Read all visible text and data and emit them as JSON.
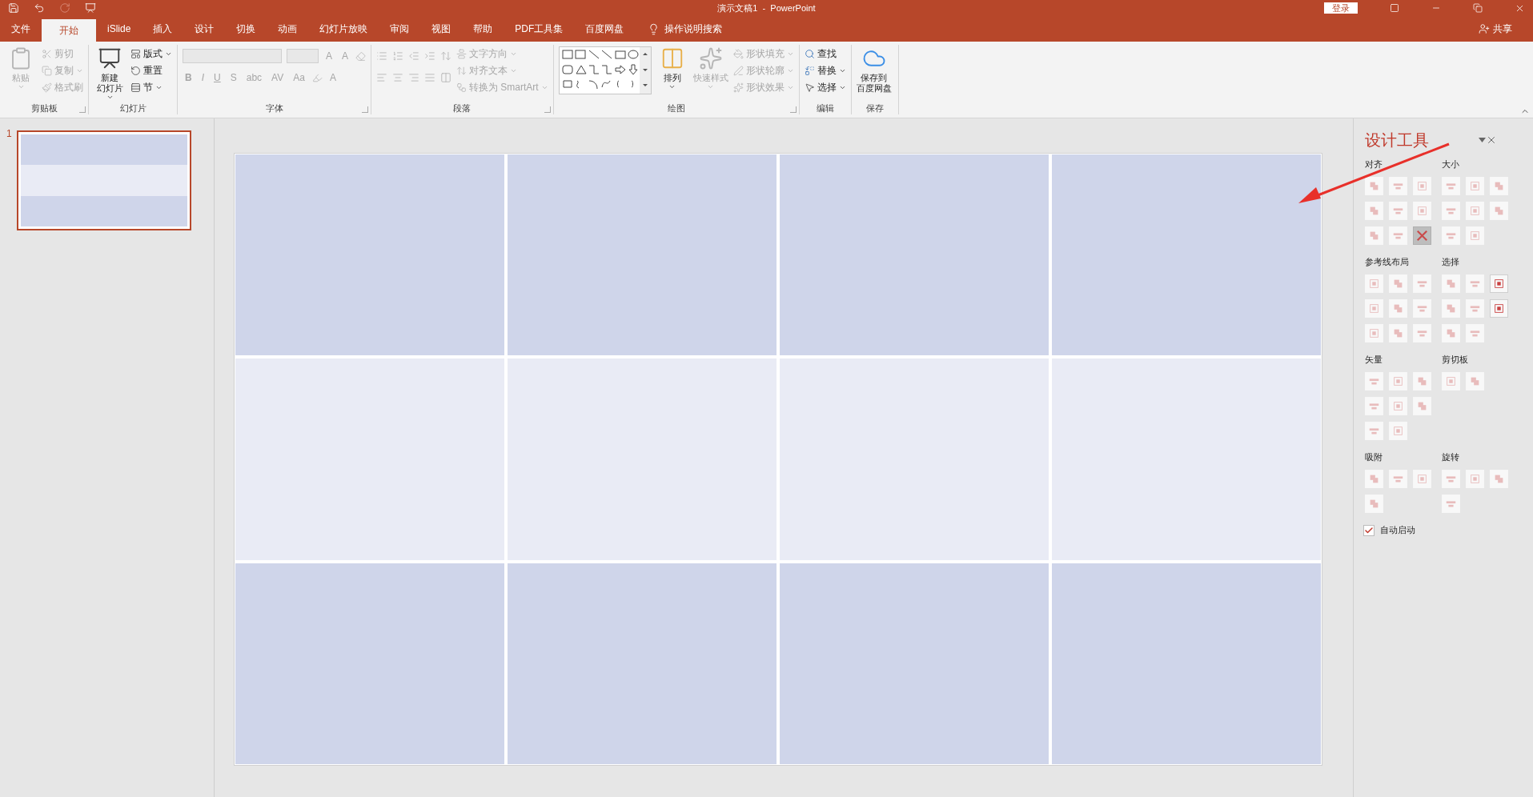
{
  "window": {
    "title": "演示文稿1  -  PowerPoint",
    "login": "登录"
  },
  "tabs": [
    {
      "label": "文件",
      "selected": false
    },
    {
      "label": "开始",
      "selected": true
    },
    {
      "label": "iSlide",
      "selected": false
    },
    {
      "label": "插入",
      "selected": false
    },
    {
      "label": "设计",
      "selected": false
    },
    {
      "label": "切换",
      "selected": false
    },
    {
      "label": "动画",
      "selected": false
    },
    {
      "label": "幻灯片放映",
      "selected": false
    },
    {
      "label": "审阅",
      "selected": false
    },
    {
      "label": "视图",
      "selected": false
    },
    {
      "label": "帮助",
      "selected": false
    },
    {
      "label": "PDF工具集",
      "selected": false
    },
    {
      "label": "百度网盘",
      "selected": false
    }
  ],
  "tell_me": "操作说明搜索",
  "share": "共享",
  "ribbon": [
    {
      "label": "剪贴板",
      "launcher": true,
      "items": [
        {
          "kind": "large",
          "label_lines": [
            "粘贴"
          ],
          "disabled": true,
          "dropdown": true
        },
        {
          "kind": "stack",
          "rows": [
            {
              "label": "剪切",
              "disabled": true,
              "dropdown": false
            },
            {
              "label": "复制",
              "disabled": true,
              "dropdown": true
            },
            {
              "label": "格式刷",
              "disabled": true,
              "dropdown": false
            }
          ]
        }
      ]
    },
    {
      "label": "幻灯片",
      "launcher": false,
      "items": [
        {
          "kind": "large",
          "label_lines": [
            "新建",
            "幻灯片"
          ],
          "disabled": false,
          "dropdown": true
        },
        {
          "kind": "stack",
          "rows": [
            {
              "label": "版式",
              "disabled": false,
              "dropdown": true
            },
            {
              "label": "重置",
              "disabled": false,
              "dropdown": false
            },
            {
              "label": "节",
              "disabled": false,
              "dropdown": true
            }
          ]
        }
      ]
    },
    {
      "label": "字体",
      "launcher": true,
      "items": [
        {
          "kind": "font",
          "size_buttons": [
            "A",
            "A"
          ],
          "format_buttons": [
            "B",
            "I",
            "U",
            "S",
            "abc",
            "AV",
            "Aa"
          ],
          "color_button": "A"
        }
      ]
    },
    {
      "label": "段落",
      "launcher": true,
      "items": [
        {
          "kind": "paragraph"
        },
        {
          "kind": "stack",
          "rows": [
            {
              "label": "文字方向",
              "disabled": true,
              "dropdown": true
            },
            {
              "label": "对齐文本",
              "disabled": true,
              "dropdown": true
            },
            {
              "label": "转换为 SmartArt",
              "disabled": true,
              "dropdown": true
            }
          ]
        }
      ]
    },
    {
      "label": "绘图",
      "launcher": true,
      "items": [
        {
          "kind": "gallery"
        },
        {
          "kind": "large",
          "label_lines": [
            "排列"
          ],
          "disabled": false,
          "dropdown": true
        },
        {
          "kind": "large",
          "label_lines": [
            "快速样式"
          ],
          "disabled": true,
          "dropdown": true
        },
        {
          "kind": "stack",
          "rows": [
            {
              "label": "形状填充",
              "disabled": true,
              "dropdown": true
            },
            {
              "label": "形状轮廓",
              "disabled": true,
              "dropdown": true
            },
            {
              "label": "形状效果",
              "disabled": true,
              "dropdown": true
            }
          ]
        }
      ]
    },
    {
      "label": "编辑",
      "launcher": false,
      "items": [
        {
          "kind": "stack",
          "rows": [
            {
              "label": "查找",
              "disabled": false,
              "dropdown": false
            },
            {
              "label": "替换",
              "disabled": false,
              "dropdown": true
            },
            {
              "label": "选择",
              "disabled": false,
              "dropdown": true
            }
          ]
        }
      ]
    },
    {
      "label": "保存",
      "launcher": false,
      "items": [
        {
          "kind": "large",
          "label_lines": [
            "保存到",
            "百度网盘"
          ],
          "disabled": false,
          "dropdown": false
        }
      ]
    }
  ],
  "slides": [
    {
      "number": "1",
      "selected": true
    }
  ],
  "slide_table": {
    "rows": [
      {
        "banded": true
      },
      {
        "banded": false
      },
      {
        "banded": true
      }
    ]
  },
  "panel": {
    "title": "设计工具",
    "sections": [
      {
        "title": "对齐",
        "tools": [
          {
            "disabled": true,
            "pressed": false
          },
          {
            "disabled": true,
            "pressed": false
          },
          {
            "disabled": true,
            "pressed": false
          },
          {
            "disabled": true,
            "pressed": false
          },
          {
            "disabled": true,
            "pressed": false
          },
          {
            "disabled": true,
            "pressed": false
          },
          {
            "disabled": true,
            "pressed": false
          },
          {
            "disabled": true,
            "pressed": false
          },
          {
            "disabled": true,
            "pressed": true
          }
        ]
      },
      {
        "title": "大小",
        "tools": [
          {
            "disabled": true,
            "pressed": false
          },
          {
            "disabled": true,
            "pressed": false
          },
          {
            "disabled": true,
            "pressed": false
          },
          {
            "disabled": true,
            "pressed": false
          },
          {
            "disabled": true,
            "pressed": false
          },
          {
            "disabled": true,
            "pressed": false
          },
          {
            "disabled": true,
            "pressed": false
          },
          {
            "disabled": true,
            "pressed": false
          }
        ]
      },
      {
        "title": "参考线布局",
        "tools": [
          {
            "disabled": true,
            "pressed": false
          },
          {
            "disabled": true,
            "pressed": false
          },
          {
            "disabled": true,
            "pressed": false
          },
          {
            "disabled": true,
            "pressed": false
          },
          {
            "disabled": true,
            "pressed": false
          },
          {
            "disabled": true,
            "pressed": false
          },
          {
            "disabled": true,
            "pressed": false
          },
          {
            "disabled": true,
            "pressed": false
          },
          {
            "disabled": true,
            "pressed": false
          }
        ]
      },
      {
        "title": "选择",
        "tools": [
          {
            "disabled": true,
            "pressed": false
          },
          {
            "disabled": true,
            "pressed": false
          },
          {
            "disabled": false,
            "pressed": false
          },
          {
            "disabled": true,
            "pressed": false
          },
          {
            "disabled": true,
            "pressed": false
          },
          {
            "disabled": false,
            "pressed": false
          },
          {
            "disabled": true,
            "pressed": false
          },
          {
            "disabled": true,
            "pressed": false
          }
        ]
      },
      {
        "title": "矢量",
        "tools": [
          {
            "disabled": true,
            "pressed": false
          },
          {
            "disabled": true,
            "pressed": false
          },
          {
            "disabled": true,
            "pressed": false
          },
          {
            "disabled": true,
            "pressed": false
          },
          {
            "disabled": true,
            "pressed": false
          },
          {
            "disabled": true,
            "pressed": false
          },
          {
            "disabled": true,
            "pressed": false
          },
          {
            "disabled": true,
            "pressed": false
          }
        ]
      },
      {
        "title": "剪切板",
        "tools": [
          {
            "disabled": true,
            "pressed": false
          },
          {
            "disabled": true,
            "pressed": false
          }
        ]
      },
      {
        "title": "吸附",
        "tools": [
          {
            "disabled": true,
            "pressed": false
          },
          {
            "disabled": true,
            "pressed": false
          },
          {
            "disabled": true,
            "pressed": false
          },
          {
            "disabled": true,
            "pressed": false
          }
        ]
      },
      {
        "title": "旋转",
        "tools": [
          {
            "disabled": true,
            "pressed": false
          },
          {
            "disabled": true,
            "pressed": false
          },
          {
            "disabled": true,
            "pressed": false
          },
          {
            "disabled": true,
            "pressed": false
          }
        ]
      }
    ],
    "auto_start": {
      "label": "自动启动",
      "checked": true
    }
  }
}
